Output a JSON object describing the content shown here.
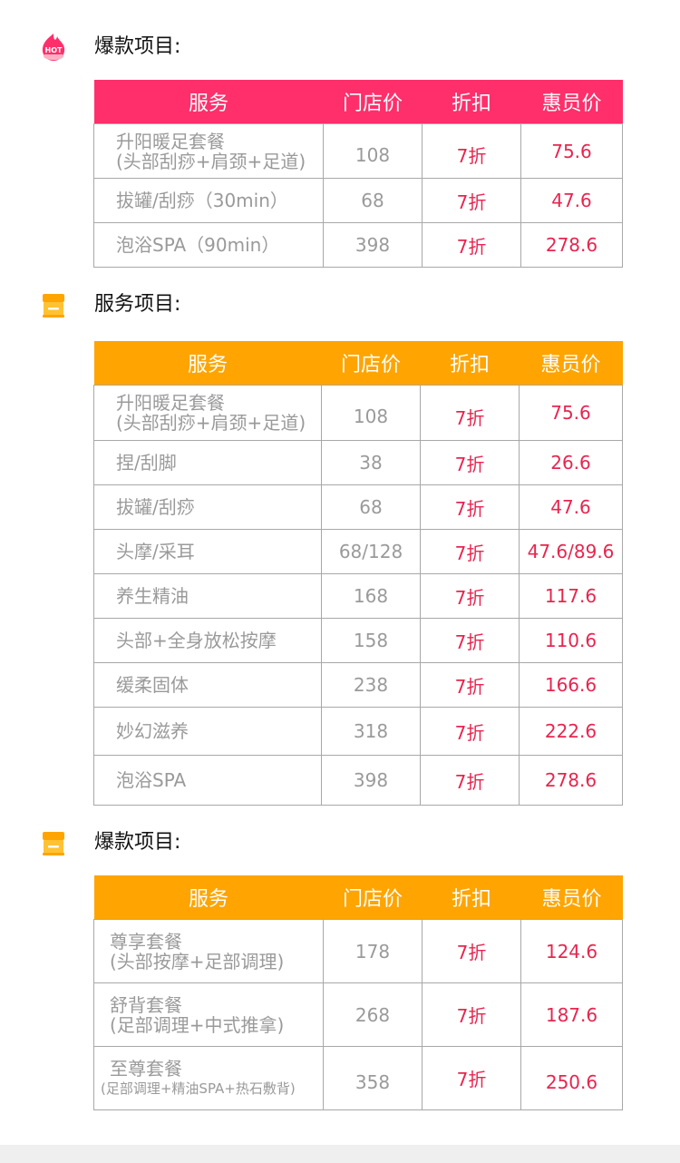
{
  "sections": [
    {
      "title": "爆款项目:",
      "icon": "hot-flame-icon",
      "header_color": "#ff2f6b",
      "headers": [
        "服务",
        "门店价",
        "折扣",
        "惠员价"
      ],
      "rows": [
        {
          "service": [
            "升阳暖足套餐",
            "(头部刮痧+肩颈+足道)"
          ],
          "store_price": "108",
          "discount": "7折",
          "member_price": "75.6"
        },
        {
          "service": [
            "拔罐/刮痧（30min）"
          ],
          "store_price": "68",
          "discount": "7折",
          "member_price": "47.6"
        },
        {
          "service": [
            "泡浴SPA（90min）"
          ],
          "store_price": "398",
          "discount": "7折",
          "member_price": "278.6"
        }
      ]
    },
    {
      "title": "服务项目:",
      "icon": "store-icon",
      "header_color": "#ffa400",
      "headers": [
        "服务",
        "门店价",
        "折扣",
        "惠员价"
      ],
      "rows": [
        {
          "service": [
            "升阳暖足套餐",
            "(头部刮痧+肩颈+足道)"
          ],
          "store_price": "108",
          "discount": "7折",
          "member_price": "75.6"
        },
        {
          "service": [
            "捏/刮脚"
          ],
          "store_price": "38",
          "discount": "7折",
          "member_price": "26.6"
        },
        {
          "service": [
            "拔罐/刮痧"
          ],
          "store_price": "68",
          "discount": "7折",
          "member_price": "47.6"
        },
        {
          "service": [
            "头摩/采耳"
          ],
          "store_price": "68/128",
          "discount": "7折",
          "member_price": "47.6/89.6"
        },
        {
          "service": [
            "养生精油"
          ],
          "store_price": "168",
          "discount": "7折",
          "member_price": "117.6"
        },
        {
          "service": [
            "头部+全身放松按摩"
          ],
          "store_price": "158",
          "discount": "7折",
          "member_price": "110.6"
        },
        {
          "service": [
            "缓柔固体"
          ],
          "store_price": "238",
          "discount": "7折",
          "member_price": "166.6"
        },
        {
          "service": [
            "妙幻滋养"
          ],
          "store_price": "318",
          "discount": "7折",
          "member_price": "222.6"
        },
        {
          "service": [
            "泡浴SPA"
          ],
          "store_price": "398",
          "discount": "7折",
          "member_price": "278.6"
        }
      ]
    },
    {
      "title": "爆款项目:",
      "icon": "store-icon",
      "header_color": "#ffa400",
      "headers": [
        "服务",
        "门店价",
        "折扣",
        "惠员价"
      ],
      "rows": [
        {
          "service": [
            "尊享套餐",
            "(头部按摩+足部调理)"
          ],
          "store_price": "178",
          "discount": "7折",
          "member_price": "124.6"
        },
        {
          "service": [
            "舒背套餐",
            "(足部调理+中式推拿)"
          ],
          "store_price": "268",
          "discount": "7折",
          "member_price": "187.6"
        },
        {
          "service": [
            "至尊套餐",
            "(足部调理+精油SPA+热石敷背)"
          ],
          "store_price": "358",
          "discount": "7折",
          "member_price": "250.6"
        }
      ]
    }
  ],
  "hot_badge_text": "HOT"
}
